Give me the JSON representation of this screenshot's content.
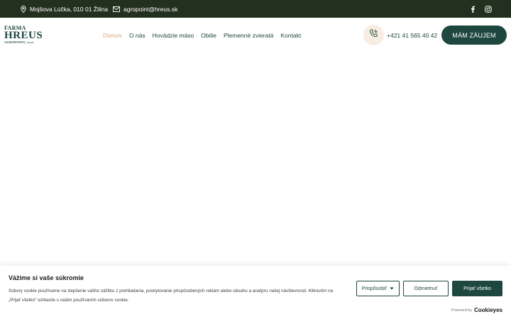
{
  "topbar": {
    "address": "Mojšova Lúčka, 010 01 Žilina",
    "email": "agropoint@hreus.sk",
    "social": [
      "facebook-icon",
      "instagram-icon"
    ]
  },
  "logo": {
    "line1": "FARMA",
    "line2": "HREUS",
    "line3": "AGROPOINT, s.r.o."
  },
  "nav": {
    "items": [
      {
        "label": "Domov",
        "active": true
      },
      {
        "label": "O nás",
        "active": false
      },
      {
        "label": "Hovädzie mäso",
        "active": false
      },
      {
        "label": "Obilie",
        "active": false
      },
      {
        "label": "Plemenné zvieratá",
        "active": false
      },
      {
        "label": "Kontakt",
        "active": false
      }
    ]
  },
  "header": {
    "phone": "+421 41 565 40 42",
    "cta_label": "MÁM ZÁUJEM"
  },
  "cookie": {
    "title": "Vážime si vaše súkromie",
    "text": "Súbory cookie používame na zlepšenie vášho zážitku z prehliadania, poskytovanie prispôsobených reklám alebo obsahu a analýzu našej návštevnosti. Kliknutím na „Prijať všetko“ súhlasíte s našim používaním súborov cookie.",
    "customize_label": "Prispôsobiť",
    "reject_label": "Odmietnuť",
    "accept_label": "Prijať všetko",
    "powered_prefix": "Powered by",
    "powered_brand": "Cookieyes"
  },
  "colors": {
    "topbar_bg": "#24301f",
    "brand_green": "#1e4740",
    "active_nav": "#d3a877",
    "phone_circle": "#f7ede2"
  }
}
